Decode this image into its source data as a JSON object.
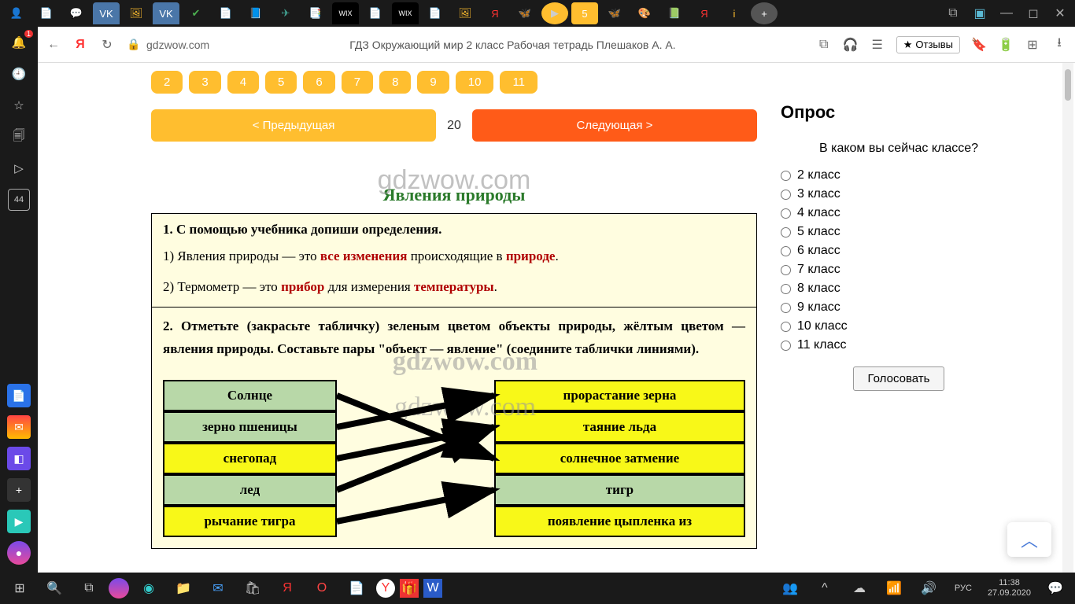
{
  "browser": {
    "url_host": "gdzwow.com",
    "page_title": "ГДЗ Окружающий мир 2 класс Рабочая тетрадь Плешаков А. А.",
    "reviews_label": "Отзывы"
  },
  "sidebar": {
    "notification_badge": "1",
    "counter_box": "44"
  },
  "pager": {
    "numbers": [
      "2",
      "3",
      "4",
      "5",
      "6",
      "7",
      "8",
      "9",
      "10",
      "11"
    ],
    "prev_label": "< Предыдущая",
    "next_label": "Следующая >",
    "current_page": "20"
  },
  "watermark": "gdzwow.com",
  "workbook": {
    "title": "Явления природы",
    "q1_prompt": "1. С помощью учебника допиши определения.",
    "a1_prefix": "1) Явления природы — это ",
    "a1_ans1": "все изменения",
    "a1_mid": " происходящие в ",
    "a1_ans2": "природе",
    "a2_prefix": "2) Термометр — это ",
    "a2_ans1": "прибор",
    "a2_mid": " для измерения ",
    "a2_ans2": "температуры",
    "q2_text": "2. Отметьте (закрасьте табличку) зеленым цветом объекты природы, жёлтым цветом — явления природы. Составьте пары \"объект — явление\" (соедините таблички линиями).",
    "left": [
      "Солнце",
      "зерно пшеницы",
      "снегопад",
      "лед",
      "рычание тигра"
    ],
    "right": [
      "прорастание зерна",
      "таяние льда",
      "солнечное затмение",
      "тигр",
      "появление цыпленка из"
    ],
    "left_colors": [
      "green",
      "green",
      "yellow",
      "green",
      "yellow"
    ],
    "right_colors": [
      "yellow",
      "yellow",
      "yellow",
      "green",
      "yellow"
    ]
  },
  "poll": {
    "title": "Опрос",
    "question": "В каком вы сейчас классе?",
    "options": [
      "2 класс",
      "3 класс",
      "4 класс",
      "5 класс",
      "6 класс",
      "7 класс",
      "8 класс",
      "9 класс",
      "10 класс",
      "11 класс"
    ],
    "vote_label": "Голосовать"
  },
  "taskbar": {
    "lang": "РУС",
    "time": "11:38",
    "date": "27.09.2020"
  }
}
